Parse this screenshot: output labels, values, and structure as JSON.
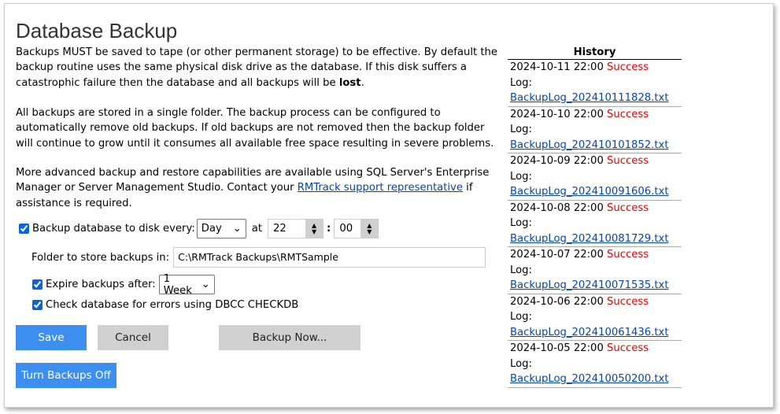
{
  "page": {
    "title": "Database Backup"
  },
  "intro": {
    "p1a": "Backups MUST be saved to tape (or other permanent storage) to be effective. By default the backup routine uses the same physical disk drive as the database. If this disk suffers a catastrophic failure then the database and all backups will be ",
    "p1b": "lost",
    "p2": "All backups are stored in a single folder. The backup process can be configured to automatically remove old backups. If old backups are not removed then the backup folder will continue to grow until it consumes all available free space resulting in severe problems.",
    "p3a": "More advanced backup and restore capabilities are available using SQL Server's Enterprise Manager or Server Management Studio. Contact your ",
    "p3link": "RMTrack support representative",
    "p3b": " if assistance is required."
  },
  "form": {
    "backup_label": "Backup database to disk every:",
    "backup_checked": true,
    "frequency": "Day",
    "at_label": "at",
    "hour": "22",
    "colon": ":",
    "minute": "00",
    "folder_label": "Folder to store backups in:",
    "folder_value": "C:\\RMTrack Backups\\RMTSample",
    "expire_label": "Expire backups after:",
    "expire_checked": true,
    "expire_value": "1 Week",
    "check_label": "Check database for errors using DBCC CHECKDB",
    "check_checked": true
  },
  "buttons": {
    "save": "Save",
    "cancel": "Cancel",
    "backup_now": "Backup Now...",
    "turn_off": "Turn Backups Off"
  },
  "colors": {
    "accent": "#3d8fef",
    "success": "#e00000",
    "link": "#0645ad"
  },
  "history": {
    "title": "History",
    "log_prefix": "Log:",
    "entries": [
      {
        "date": "2024-10-11 22:00",
        "status": "Success",
        "log": "BackupLog_202410111828.txt"
      },
      {
        "date": "2024-10-10 22:00",
        "status": "Success",
        "log": "BackupLog_202410101852.txt"
      },
      {
        "date": "2024-10-09 22:00",
        "status": "Success",
        "log": "BackupLog_202410091606.txt"
      },
      {
        "date": "2024-10-08 22:00",
        "status": "Success",
        "log": "BackupLog_202410081729.txt"
      },
      {
        "date": "2024-10-07 22:00",
        "status": "Success",
        "log": "BackupLog_202410071535.txt"
      },
      {
        "date": "2024-10-06 22:00",
        "status": "Success",
        "log": "BackupLog_202410061436.txt"
      },
      {
        "date": "2024-10-05 22:00",
        "status": "Success",
        "log": "BackupLog_202410050200.txt"
      }
    ]
  }
}
